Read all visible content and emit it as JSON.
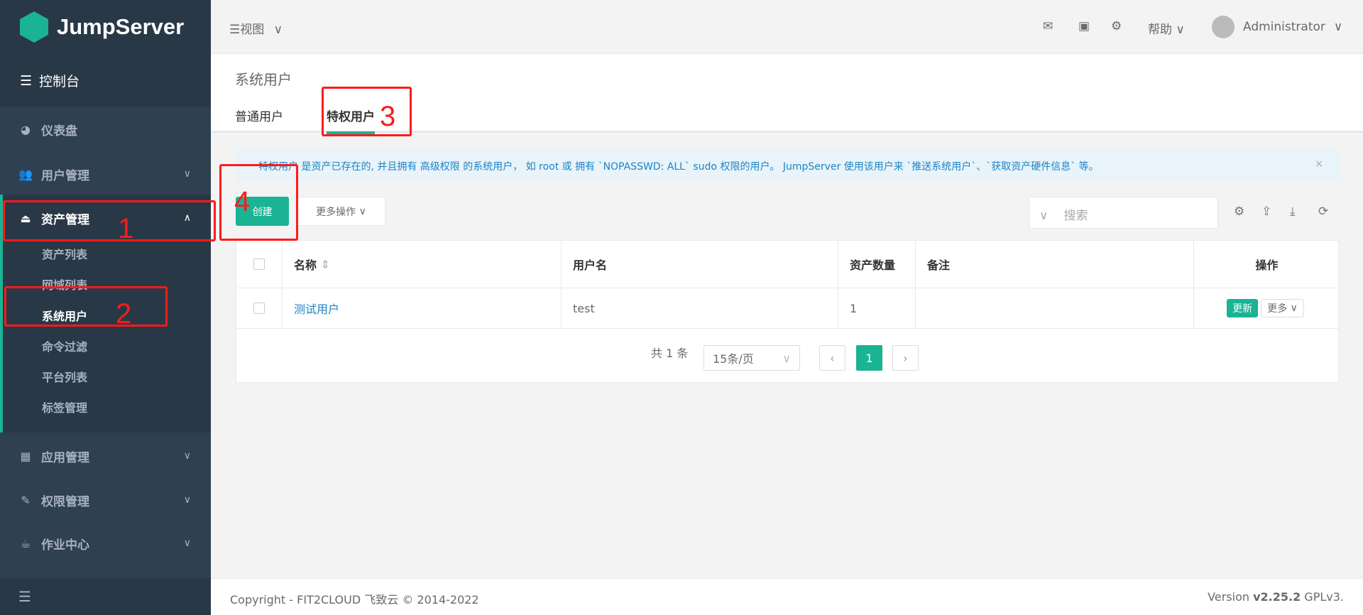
{
  "brand": "JumpServer",
  "sidebar": {
    "console": "控制台",
    "items": [
      {
        "label": "仪表盘",
        "icon": "dashboard-icon"
      },
      {
        "label": "用户管理",
        "icon": "users-icon"
      },
      {
        "label": "资产管理",
        "icon": "inbox-icon"
      },
      {
        "label": "应用管理",
        "icon": "grid-icon"
      },
      {
        "label": "权限管理",
        "icon": "edit-icon"
      },
      {
        "label": "作业中心",
        "icon": "coffee-icon"
      }
    ],
    "sub_items": [
      "资产列表",
      "网域列表",
      "系统用户",
      "命令过滤",
      "平台列表",
      "标签管理"
    ]
  },
  "topbar": {
    "view": "视图",
    "help": "帮助",
    "user": "Administrator"
  },
  "page": {
    "title": "系统用户",
    "tabs": [
      "普通用户",
      "特权用户"
    ]
  },
  "alert": {
    "text": "特权用户 是资产已存在的, 并且拥有 高级权限 的系统用户， 如 root 或 拥有 `NOPASSWD: ALL` sudo 权限的用户。 JumpServer 使用该用户来 `推送系统用户`、`获取资产硬件信息` 等。",
    "close": "×"
  },
  "toolbar": {
    "create": "创建",
    "more": "更多操作",
    "search_placeholder": "搜索"
  },
  "table": {
    "headers": [
      "名称",
      "用户名",
      "资产数量",
      "备注",
      "操作"
    ],
    "rows": [
      {
        "name": "测试用户",
        "username": "test",
        "count": "1",
        "remark": "",
        "update": "更新",
        "more": "更多"
      }
    ]
  },
  "pagination": {
    "total": "共 1 条",
    "page_size": "15条/页",
    "current": "1"
  },
  "footer": {
    "copyright": "Copyright - FIT2CLOUD 飞致云 © 2014-2022",
    "version_prefix": "Version ",
    "version": "v2.25.2",
    "license": " GPLv3."
  },
  "annotations": [
    "1",
    "2",
    "3",
    "4"
  ]
}
